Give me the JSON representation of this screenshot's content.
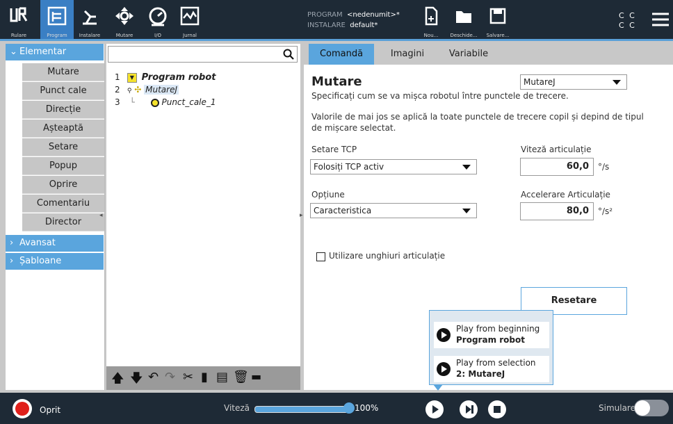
{
  "topbar": {
    "nav": [
      {
        "label": "Rulare",
        "icon": "ur-logo-icon"
      },
      {
        "label": "Program",
        "icon": "program-icon"
      },
      {
        "label": "Instalare",
        "icon": "robot-arm-icon"
      },
      {
        "label": "Mutare",
        "icon": "move-arrows-icon"
      },
      {
        "label": "I/O",
        "icon": "io-gauge-icon"
      },
      {
        "label": "Jurnal",
        "icon": "log-chart-icon"
      }
    ],
    "program_key": "PROGRAM",
    "program_value": "<nedenumit>*",
    "install_key": "INSTALARE",
    "install_value": "default*",
    "file_buttons": [
      {
        "label": "Nou...",
        "icon": "new-file-icon"
      },
      {
        "label": "Deschide...",
        "icon": "folder-icon"
      },
      {
        "label": "Salvare...",
        "icon": "save-icon"
      }
    ],
    "cc_top": "C C",
    "cc_bottom": "C C"
  },
  "sidebar": {
    "elementar": "Elementar",
    "items": [
      "Mutare",
      "Punct cale",
      "Direcție",
      "Așteaptă",
      "Setare",
      "Popup",
      "Oprire",
      "Comentariu",
      "Director"
    ],
    "avansat": "Avansat",
    "sabloane": "Șabloane"
  },
  "tree": {
    "rows": [
      {
        "num": "1",
        "label": "Program robot"
      },
      {
        "num": "2",
        "label": "MutareJ"
      },
      {
        "num": "3",
        "label": "Punct_cale_1"
      }
    ]
  },
  "tabs": [
    "Comandă",
    "Imagini",
    "Variabile"
  ],
  "command": {
    "title": "Mutare",
    "move_type": "MutareJ",
    "desc1": "Specificați cum se va mișca robotul între punctele de trecere.",
    "desc2": "Valorile de mai jos se aplică la toate punctele de trecere copil și depind de tipul de mișcare selectat.",
    "tcp_label": "Setare TCP",
    "tcp_value": "Folosiți TCP activ",
    "speed_label": "Viteză articulație",
    "speed_value": "60,0",
    "speed_unit": "°/s",
    "option_label": "Opțiune",
    "option_value": "Caracteristica",
    "accel_label": "Accelerare Articulație",
    "accel_value": "80,0",
    "accel_unit": "°/s²",
    "joint_angles": "Utilizare unghiuri articulație",
    "reset": "Resetare"
  },
  "popup": {
    "item1_line1": "Play from beginning",
    "item1_line2": "Program robot",
    "item2_line1": "Play from selection",
    "item2_line2": "2: MutareJ"
  },
  "bottom": {
    "status": "Oprit",
    "speed_label": "Viteză",
    "speed_value": "100%",
    "speed_fraction": 1.0,
    "sim_label": "Simulare"
  },
  "colors": {
    "accent": "#5aa5dd",
    "topbar": "#1e2a36",
    "stop": "#e0201b"
  }
}
